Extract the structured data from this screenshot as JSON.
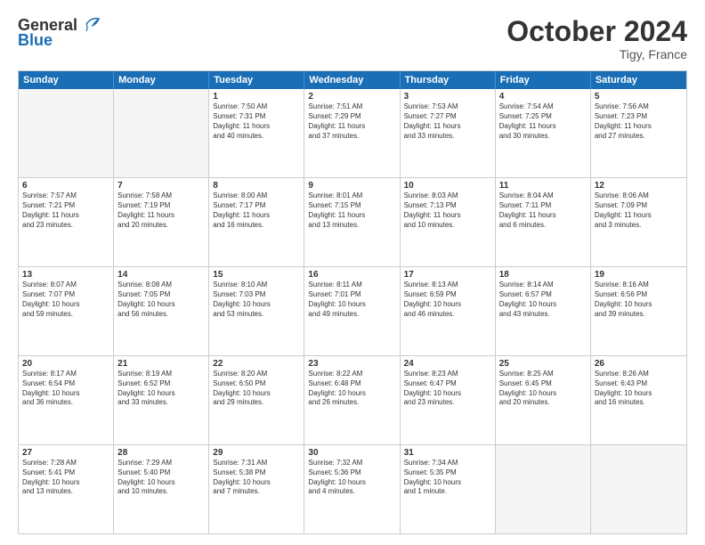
{
  "header": {
    "logo_line1": "General",
    "logo_line2": "Blue",
    "month": "October 2024",
    "location": "Tigy, France"
  },
  "weekdays": [
    "Sunday",
    "Monday",
    "Tuesday",
    "Wednesday",
    "Thursday",
    "Friday",
    "Saturday"
  ],
  "rows": [
    [
      {
        "day": "",
        "text": "",
        "empty": true
      },
      {
        "day": "",
        "text": "",
        "empty": true
      },
      {
        "day": "1",
        "text": "Sunrise: 7:50 AM\nSunset: 7:31 PM\nDaylight: 11 hours\nand 40 minutes."
      },
      {
        "day": "2",
        "text": "Sunrise: 7:51 AM\nSunset: 7:29 PM\nDaylight: 11 hours\nand 37 minutes."
      },
      {
        "day": "3",
        "text": "Sunrise: 7:53 AM\nSunset: 7:27 PM\nDaylight: 11 hours\nand 33 minutes."
      },
      {
        "day": "4",
        "text": "Sunrise: 7:54 AM\nSunset: 7:25 PM\nDaylight: 11 hours\nand 30 minutes."
      },
      {
        "day": "5",
        "text": "Sunrise: 7:56 AM\nSunset: 7:23 PM\nDaylight: 11 hours\nand 27 minutes."
      }
    ],
    [
      {
        "day": "6",
        "text": "Sunrise: 7:57 AM\nSunset: 7:21 PM\nDaylight: 11 hours\nand 23 minutes."
      },
      {
        "day": "7",
        "text": "Sunrise: 7:58 AM\nSunset: 7:19 PM\nDaylight: 11 hours\nand 20 minutes."
      },
      {
        "day": "8",
        "text": "Sunrise: 8:00 AM\nSunset: 7:17 PM\nDaylight: 11 hours\nand 16 minutes."
      },
      {
        "day": "9",
        "text": "Sunrise: 8:01 AM\nSunset: 7:15 PM\nDaylight: 11 hours\nand 13 minutes."
      },
      {
        "day": "10",
        "text": "Sunrise: 8:03 AM\nSunset: 7:13 PM\nDaylight: 11 hours\nand 10 minutes."
      },
      {
        "day": "11",
        "text": "Sunrise: 8:04 AM\nSunset: 7:11 PM\nDaylight: 11 hours\nand 6 minutes."
      },
      {
        "day": "12",
        "text": "Sunrise: 8:06 AM\nSunset: 7:09 PM\nDaylight: 11 hours\nand 3 minutes."
      }
    ],
    [
      {
        "day": "13",
        "text": "Sunrise: 8:07 AM\nSunset: 7:07 PM\nDaylight: 10 hours\nand 59 minutes."
      },
      {
        "day": "14",
        "text": "Sunrise: 8:08 AM\nSunset: 7:05 PM\nDaylight: 10 hours\nand 56 minutes."
      },
      {
        "day": "15",
        "text": "Sunrise: 8:10 AM\nSunset: 7:03 PM\nDaylight: 10 hours\nand 53 minutes."
      },
      {
        "day": "16",
        "text": "Sunrise: 8:11 AM\nSunset: 7:01 PM\nDaylight: 10 hours\nand 49 minutes."
      },
      {
        "day": "17",
        "text": "Sunrise: 8:13 AM\nSunset: 6:59 PM\nDaylight: 10 hours\nand 46 minutes."
      },
      {
        "day": "18",
        "text": "Sunrise: 8:14 AM\nSunset: 6:57 PM\nDaylight: 10 hours\nand 43 minutes."
      },
      {
        "day": "19",
        "text": "Sunrise: 8:16 AM\nSunset: 6:56 PM\nDaylight: 10 hours\nand 39 minutes."
      }
    ],
    [
      {
        "day": "20",
        "text": "Sunrise: 8:17 AM\nSunset: 6:54 PM\nDaylight: 10 hours\nand 36 minutes."
      },
      {
        "day": "21",
        "text": "Sunrise: 8:19 AM\nSunset: 6:52 PM\nDaylight: 10 hours\nand 33 minutes."
      },
      {
        "day": "22",
        "text": "Sunrise: 8:20 AM\nSunset: 6:50 PM\nDaylight: 10 hours\nand 29 minutes."
      },
      {
        "day": "23",
        "text": "Sunrise: 8:22 AM\nSunset: 6:48 PM\nDaylight: 10 hours\nand 26 minutes."
      },
      {
        "day": "24",
        "text": "Sunrise: 8:23 AM\nSunset: 6:47 PM\nDaylight: 10 hours\nand 23 minutes."
      },
      {
        "day": "25",
        "text": "Sunrise: 8:25 AM\nSunset: 6:45 PM\nDaylight: 10 hours\nand 20 minutes."
      },
      {
        "day": "26",
        "text": "Sunrise: 8:26 AM\nSunset: 6:43 PM\nDaylight: 10 hours\nand 16 minutes."
      }
    ],
    [
      {
        "day": "27",
        "text": "Sunrise: 7:28 AM\nSunset: 5:41 PM\nDaylight: 10 hours\nand 13 minutes."
      },
      {
        "day": "28",
        "text": "Sunrise: 7:29 AM\nSunset: 5:40 PM\nDaylight: 10 hours\nand 10 minutes."
      },
      {
        "day": "29",
        "text": "Sunrise: 7:31 AM\nSunset: 5:38 PM\nDaylight: 10 hours\nand 7 minutes."
      },
      {
        "day": "30",
        "text": "Sunrise: 7:32 AM\nSunset: 5:36 PM\nDaylight: 10 hours\nand 4 minutes."
      },
      {
        "day": "31",
        "text": "Sunrise: 7:34 AM\nSunset: 5:35 PM\nDaylight: 10 hours\nand 1 minute."
      },
      {
        "day": "",
        "text": "",
        "empty": true
      },
      {
        "day": "",
        "text": "",
        "empty": true
      }
    ]
  ]
}
